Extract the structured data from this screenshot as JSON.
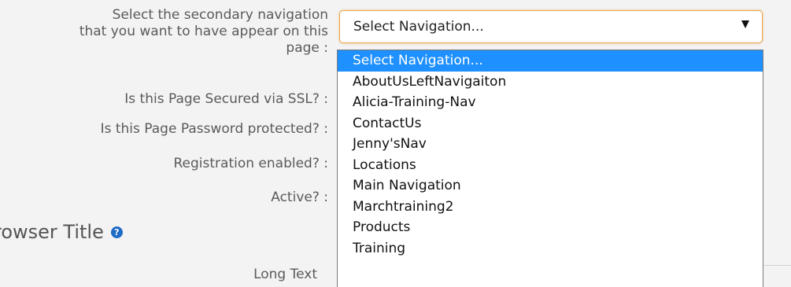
{
  "form": {
    "secondary_nav_label_lines": [
      "Select the secondary navigation",
      "that you want to have appear on this",
      "page :"
    ],
    "ssl_label": "Is this Page Secured via SSL? :",
    "password_label": "Is this Page Password protected? :",
    "registration_label": "Registration enabled? :",
    "active_label": "Active? :",
    "section_title": "rowser Title",
    "help_icon": "question-icon",
    "long_text_label": "Long Text"
  },
  "select": {
    "value": "Select Navigation...",
    "arrow_icon": "caret-down-icon",
    "options": [
      "Select Navigation...",
      "AboutUsLeftNavigaiton",
      "Alicia-Training-Nav",
      "ContactUs",
      "Jenny'sNav",
      "Locations",
      "Main Navigation",
      "Marchtraining2",
      "Products",
      "Training"
    ],
    "selected_index": 0
  },
  "colors": {
    "highlight": "#1e90ff",
    "focus_border": "#e8a24a",
    "help_icon": "#1f6bc6"
  }
}
